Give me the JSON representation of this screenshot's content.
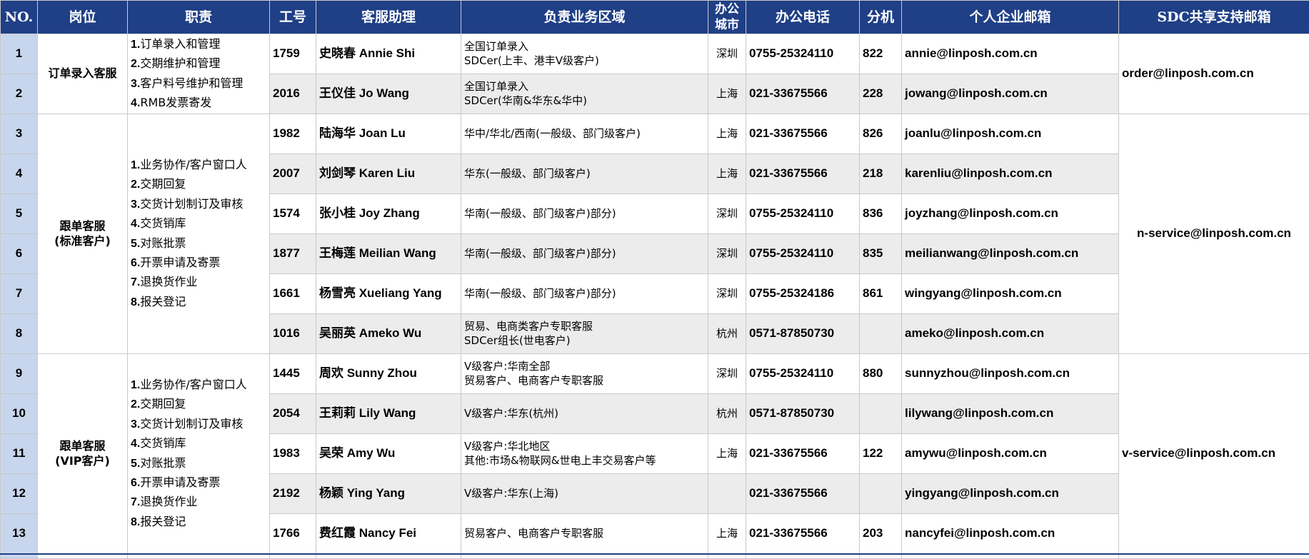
{
  "headers": {
    "no": "NO.",
    "position": "岗位",
    "duty": "职责",
    "emp_id": "工号",
    "assistant": "客服助理",
    "area": "负责业务区域",
    "city_line1": "办公",
    "city_line2": "城市",
    "phone": "办公电话",
    "ext": "分机",
    "email": "个人企业邮箱",
    "sdc": "SDC共享支持邮箱"
  },
  "groups": [
    {
      "position_lines": [
        "订单录入客服"
      ],
      "duties": [
        {
          "num": "1.",
          "text": "订单录入和管理"
        },
        {
          "num": "2.",
          "text": "交期维护和管理"
        },
        {
          "num": "3.",
          "text": "客户料号维护和管理"
        },
        {
          "num": "4.",
          "text": "RMB发票寄发"
        }
      ],
      "sdc_email": "order@linposh.com.cn"
    },
    {
      "position_lines": [
        "跟单客服",
        "(标准客户)"
      ],
      "duties": [
        {
          "num": "1.",
          "text": "业务协作/客户窗口人"
        },
        {
          "num": "2.",
          "text": "交期回复"
        },
        {
          "num": "3.",
          "text": "交货计划制订及审核"
        },
        {
          "num": "4.",
          "text": "交货销库"
        },
        {
          "num": "5.",
          "text": "对账批票"
        },
        {
          "num": "6.",
          "text": "开票申请及寄票"
        },
        {
          "num": "7.",
          "text": "退换货作业"
        },
        {
          "num": "8.",
          "text": "报关登记"
        }
      ],
      "sdc_email": "n-service@linposh.com.cn"
    },
    {
      "position_lines": [
        "跟单客服",
        "(VIP客户)"
      ],
      "duties": [
        {
          "num": "1.",
          "text": "业务协作/客户窗口人"
        },
        {
          "num": "2.",
          "text": "交期回复"
        },
        {
          "num": "3.",
          "text": "交货计划制订及审核"
        },
        {
          "num": "4.",
          "text": "交货销库"
        },
        {
          "num": "5.",
          "text": "对账批票"
        },
        {
          "num": "6.",
          "text": "开票申请及寄票"
        },
        {
          "num": "7.",
          "text": "退换货作业"
        },
        {
          "num": "8.",
          "text": "报关登记"
        }
      ],
      "sdc_email": "v-service@linposh.com.cn"
    }
  ],
  "rows": [
    {
      "no": "1",
      "id": "1759",
      "name": "史晓春 Annie Shi",
      "area": [
        "全国订单录入",
        "SDCer(上丰、港丰V级客户)"
      ],
      "city": "深圳",
      "phone": "0755-25324110",
      "ext": "822",
      "email": "annie@linposh.com.cn"
    },
    {
      "no": "2",
      "id": "2016",
      "name": "王仪佳 Jo Wang",
      "area": [
        "全国订单录入",
        "SDCer(华南&华东&华中)"
      ],
      "city": "上海",
      "phone": "021-33675566",
      "ext": "228",
      "email": "jowang@linposh.com.cn"
    },
    {
      "no": "3",
      "id": "1982",
      "name": "陆海华 Joan Lu",
      "area": [
        "华中/华北/西南(一般级、部门级客户)"
      ],
      "city": "上海",
      "phone": "021-33675566",
      "ext": "826",
      "email": "joanlu@linposh.com.cn"
    },
    {
      "no": "4",
      "id": "2007",
      "name": "刘剑琴 Karen Liu",
      "area": [
        "华东(一般级、部门级客户)"
      ],
      "city": "上海",
      "phone": "021-33675566",
      "ext": "218",
      "email": "karenliu@linposh.com.cn"
    },
    {
      "no": "5",
      "id": "1574",
      "name": "张小桂 Joy Zhang",
      "area": [
        "华南(一般级、部门级客户)部分)"
      ],
      "city": "深圳",
      "phone": "0755-25324110",
      "ext": "836",
      "email": "joyzhang@linposh.com.cn"
    },
    {
      "no": "6",
      "id": "1877",
      "name": "王梅莲 Meilian Wang",
      "area": [
        "华南(一般级、部门级客户)部分)"
      ],
      "city": "深圳",
      "phone": "0755-25324110",
      "ext": "835",
      "email": "meilianwang@linposh.com.cn"
    },
    {
      "no": "7",
      "id": "1661",
      "name": "杨雪亮 Xueliang Yang",
      "area": [
        "华南(一般级、部门级客户)部分)"
      ],
      "city": "深圳",
      "phone": "0755-25324186",
      "ext": "861",
      "email": "wingyang@linposh.com.cn"
    },
    {
      "no": "8",
      "id": "1016",
      "name": "吴丽英 Ameko Wu",
      "area": [
        "贸易、电商类客户专职客服",
        "SDCer组长(世电客户)"
      ],
      "city": "杭州",
      "phone": "0571-87850730",
      "ext": "",
      "email": "ameko@linposh.com.cn"
    },
    {
      "no": "9",
      "id": "1445",
      "name": "周欢 Sunny Zhou",
      "area": [
        "V级客户:华南全部",
        "贸易客户、电商客户专职客服"
      ],
      "city": "深圳",
      "phone": "0755-25324110",
      "ext": "880",
      "email": "sunnyzhou@linposh.com.cn"
    },
    {
      "no": "10",
      "id": "2054",
      "name": "王莉莉 Lily Wang",
      "area": [
        "V级客户:华东(杭州)"
      ],
      "city": "杭州",
      "phone": "0571-87850730",
      "ext": "",
      "email": "lilywang@linposh.com.cn"
    },
    {
      "no": "11",
      "id": "1983",
      "name": "吴荣 Amy Wu",
      "area": [
        "V级客户:华北地区",
        "其他:市场&物联网&世电上丰交易客户等"
      ],
      "city": "上海",
      "phone": "021-33675566",
      "ext": "122",
      "email": "amywu@linposh.com.cn"
    },
    {
      "no": "12",
      "id": "2192",
      "name": "杨颖 Ying Yang",
      "area": [
        "V级客户:华东(上海)"
      ],
      "city": "",
      "phone": "021-33675566",
      "ext": "",
      "email": "yingyang@linposh.com.cn"
    },
    {
      "no": "13",
      "id": "1766",
      "name": "费红霞 Nancy Fei",
      "area": [
        "贸易客户、电商客户专职客服"
      ],
      "city": "上海",
      "phone": "021-33675566",
      "ext": "203",
      "email": "nancyfei@linposh.com.cn"
    }
  ],
  "colors": {
    "header_bg": "#1f3f86",
    "header_text": "#ffffff",
    "no_column_bg": "#c7d6ec",
    "alt_row_bg": "#ececec"
  }
}
